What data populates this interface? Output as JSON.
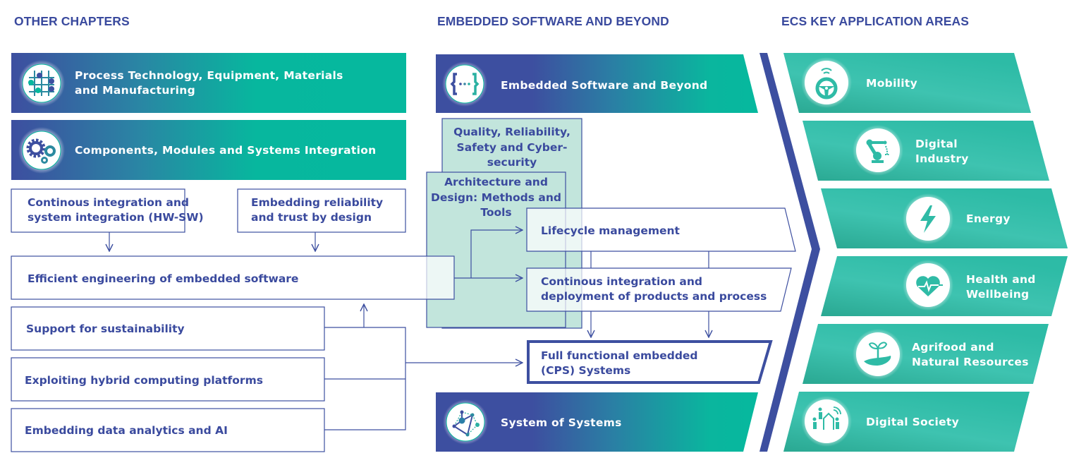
{
  "headers": {
    "left": "OTHER CHAPTERS",
    "middle": "EMBEDDED SOFTWARE AND BEYOND",
    "right": "ECS KEY APPLICATION AREAS"
  },
  "colors": {
    "navy": "#3d4fa0",
    "teal": "#06b89e",
    "light_teal": "#c2e5dc",
    "app_teal": "#2fbba6",
    "text": "#3a4a9e"
  },
  "other_chapters": [
    {
      "label_line1": "Process Technology, Equipment, Materials",
      "label_line2": "and Manufacturing",
      "icon": "process-grid-icon"
    },
    {
      "label": "Components, Modules and Systems Integration",
      "icon": "gears-icon"
    }
  ],
  "left_boxes": {
    "ci_system": {
      "line1": "Continous integration and",
      "line2": "system integration (HW-SW)"
    },
    "reliability": {
      "line1": "Embedding reliability",
      "line2": "and trust by design"
    },
    "efficient": "Efficient engineering of embedded software",
    "sustainability": "Support for sustainability",
    "hybrid": "Exploiting hybrid computing platforms",
    "data_ai": "Embedding data analytics and AI"
  },
  "middle": {
    "banner_top": {
      "label": "Embedded Software and Beyond",
      "icon": "curly-braces-icon"
    },
    "quality": {
      "line1": "Quality, Reliability,",
      "line2": "Safety and Cyber-",
      "line3": "security"
    },
    "architecture": {
      "line1": "Architecture and",
      "line2": "Design: Methods and",
      "line3": "Tools"
    },
    "lifecycle": "Lifecycle management",
    "ci_deploy": {
      "line1": "Continous integration and",
      "line2": "deployment of products and process"
    },
    "full_functional": {
      "line1": "Full functional embedded",
      "line2": "(CPS) Systems"
    },
    "banner_bottom": {
      "label": "System of Systems",
      "icon": "network-icon"
    }
  },
  "application_areas": [
    {
      "label_line1": "Mobility",
      "label_line2": "",
      "icon": "steering-wheel-icon"
    },
    {
      "label_line1": "Digital",
      "label_line2": "Industry",
      "icon": "robot-arm-icon"
    },
    {
      "label_line1": "Energy",
      "label_line2": "",
      "icon": "lightning-icon"
    },
    {
      "label_line1": "Health and",
      "label_line2": "Wellbeing",
      "icon": "heart-pulse-icon"
    },
    {
      "label_line1": "Agrifood and",
      "label_line2": "Natural Resources",
      "icon": "plant-hand-icon"
    },
    {
      "label_line1": "Digital Society",
      "label_line2": "",
      "icon": "people-city-icon"
    }
  ]
}
